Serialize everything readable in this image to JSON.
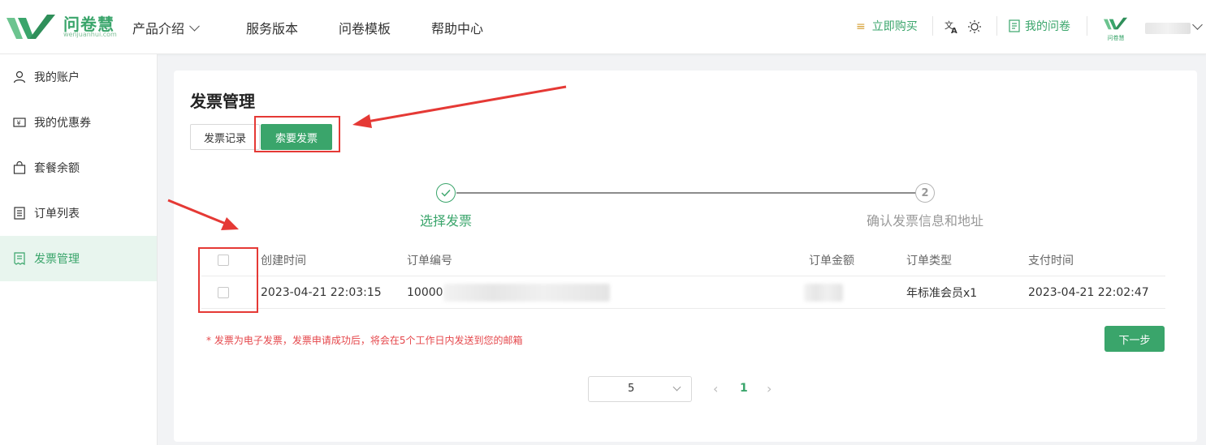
{
  "header": {
    "logo_text": "问卷慧",
    "logo_sub": "wenjuanhui.com",
    "nav": [
      {
        "label": "产品介绍",
        "has_dropdown": true
      },
      {
        "label": "服务版本"
      },
      {
        "label": "问卷模板"
      },
      {
        "label": "帮助中心"
      }
    ],
    "buy_label": "立即购买",
    "my_surveys_label": "我的问卷",
    "avatar_text": "问卷慧",
    "colors": {
      "brand": "#3aa56b",
      "buy_icon": "#d6a23a"
    }
  },
  "sidebar": {
    "items": [
      {
        "label": "我的账户",
        "icon": "user-icon"
      },
      {
        "label": "我的优惠券",
        "icon": "coupon-icon"
      },
      {
        "label": "套餐余额",
        "icon": "bag-icon"
      },
      {
        "label": "订单列表",
        "icon": "list-icon"
      },
      {
        "label": "发票管理",
        "icon": "invoice-icon",
        "active": true
      }
    ]
  },
  "main": {
    "title": "发票管理",
    "tabs": [
      {
        "label": "发票记录"
      },
      {
        "label": "索要发票",
        "active": true
      }
    ],
    "steps": [
      {
        "label": "选择发票",
        "status": "done"
      },
      {
        "label": "确认发票信息和地址",
        "status": "pending",
        "number": "2"
      }
    ],
    "table": {
      "columns": [
        "创建时间",
        "订单编号",
        "订单金额",
        "订单类型",
        "支付时间"
      ],
      "rows": [
        {
          "created": "2023-04-21 22:03:15",
          "order_no": "10000",
          "amount": "",
          "type": "年标准会员x1",
          "paid": "2023-04-21 22:02:47"
        }
      ]
    },
    "note": "* 发票为电子发票，发票申请成功后，将会在5个工作日内发送到您的邮箱",
    "next_label": "下一步",
    "pagination": {
      "page_size": "5",
      "current_page": "1"
    }
  }
}
